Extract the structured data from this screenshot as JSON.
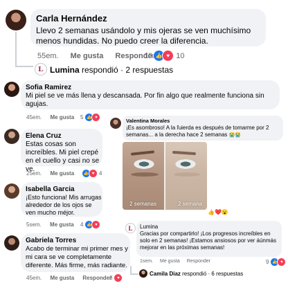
{
  "comments": [
    {
      "name": "Carla Hernández",
      "text": "Llevo 2 semanas usándolo y mis ojeras se ven muchísimo menos hundidas. No puedo creer la diferencia.",
      "time": "55em.",
      "like_label": "Me gusta",
      "reply_label": "Responder",
      "reaction_count": "10",
      "page_reply": {
        "name": "Lumina",
        "verb": "respondió",
        "count": "· 2 respuestas"
      }
    },
    {
      "name": "Sofia Ramirez",
      "text": "Mi piel se ve más llena y descansada. Por fin algo que realmente funciona sin agujas.",
      "time": "45em.",
      "like_label": "Me gusta",
      "reply_label": "",
      "reaction_count": "5"
    },
    {
      "name": "Elena Cruz",
      "text": "Estas cosas son increíbles. Mi piel crepé en el cuello y casi no se ve.",
      "time": "25em.",
      "like_label": "Me gusta",
      "reaction_count": "4"
    },
    {
      "name": "Isabella Garcia",
      "text": "¡Esto funciona! Mis arrugas alrededor de los ojos se ven mucho méjor.",
      "time": "5sem.",
      "like_label": "Me gusta",
      "reaction_count": "4"
    },
    {
      "name": "Gabriela Torres",
      "text": "Acabo de terminar mi primer mes y mi cara se ve completamente diferente. Más firme, más radiante.",
      "time": "45em.",
      "like_label": "Me gusta",
      "reply_label": "Responder",
      "reaction_count": "8"
    }
  ],
  "thread": {
    "name": "Valentina Morales",
    "text": "¡Es asombroso! A la ľuierda es después de tomarme por 2 semanas... a la derecha hace 2 semanas",
    "emoji": "😭😭",
    "photo_label_left": "2 semanas",
    "photo_label_right": "2 semana",
    "reaction_emoji": "👍❤️😮",
    "reply": {
      "name": "Lumina",
      "text": "Gracias por compartirlo! ¡Los progresos increíbles en solo en 2 semanas! ¡Estamos ansiosos por ver áúnmás mejorar en las próximas semanas!",
      "time": "1sem.",
      "like_label": "Me gusta",
      "reply_label": "Responder",
      "reaction_count": "9"
    },
    "more_reply": {
      "name": "Camila Diaz",
      "verb": "respondió",
      "count": "· 6 respuestas"
    }
  },
  "logo_letter": "L",
  "colors": {
    "like_blue": "#1877f2",
    "heart_red": "#f33e58",
    "bubble": "#f0f2f5",
    "meta_gray": "#65676b",
    "brand": "#a0153e"
  }
}
